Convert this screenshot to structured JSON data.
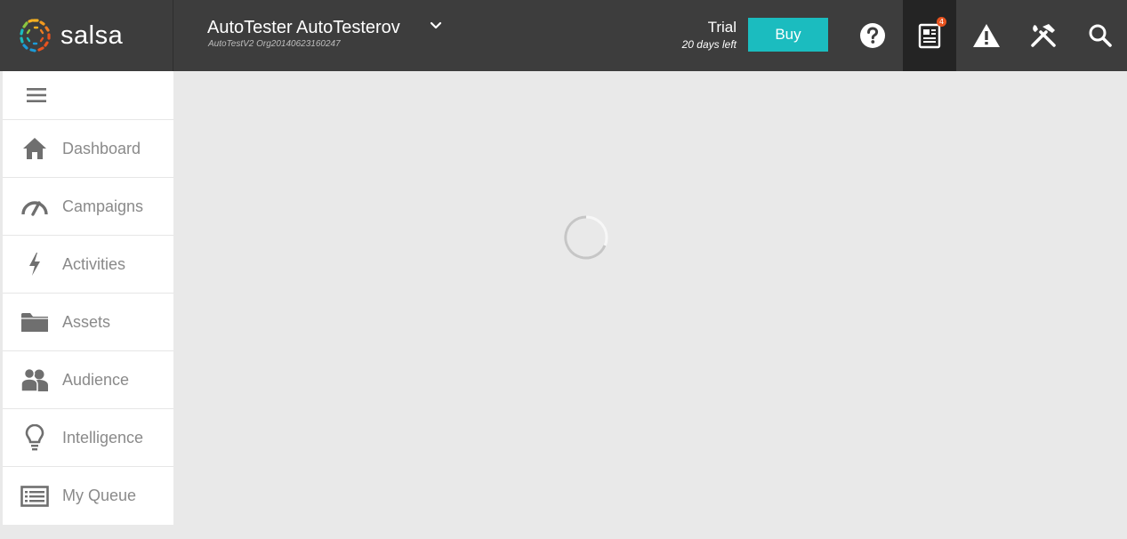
{
  "header": {
    "logo_text": "salsa",
    "account_name": "AutoTester AutoTesterov",
    "account_org": "AutoTestV2 Org20140623160247",
    "trial_label": "Trial",
    "trial_days": "20 days left",
    "buy_label": "Buy",
    "notification_count": "4",
    "icons": [
      "help-icon",
      "news-icon",
      "alert-icon",
      "tools-icon",
      "search-icon"
    ],
    "colors": {
      "bar": "#3d3d3d",
      "active_icon_bg": "#242424",
      "buy_button": "#1bbcbf",
      "badge": "#e8531f"
    }
  },
  "sidebar": {
    "items": [
      {
        "label": "Dashboard",
        "icon": "home-icon"
      },
      {
        "label": "Campaigns",
        "icon": "speedometer-icon"
      },
      {
        "label": "Activities",
        "icon": "lightning-icon"
      },
      {
        "label": "Assets",
        "icon": "folder-icon"
      },
      {
        "label": "Audience",
        "icon": "people-icon"
      },
      {
        "label": "Intelligence",
        "icon": "lightbulb-icon"
      },
      {
        "label": "My Queue",
        "icon": "list-icon"
      }
    ]
  },
  "main": {
    "state": "loading"
  }
}
